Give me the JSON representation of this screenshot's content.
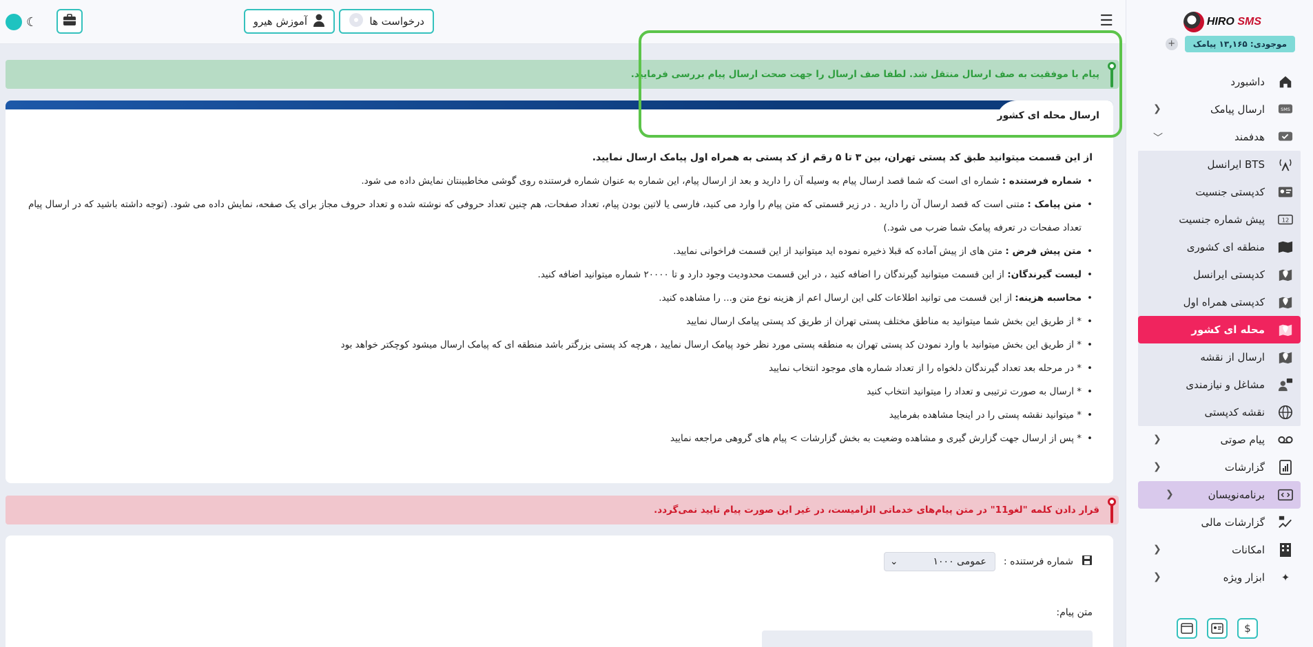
{
  "brand": {
    "logo_main": "HIRO",
    "logo_sub": "SMS"
  },
  "balance": {
    "label": "موجودی: ۱۳,۱۶۵ پیامک"
  },
  "sidebar": {
    "items": [
      {
        "label": "داشبورد",
        "icon": "home-icon"
      },
      {
        "label": "ارسال پیامک",
        "icon": "sms-icon"
      },
      {
        "label": "هدفمند",
        "icon": "target-icon"
      }
    ],
    "sub_items": [
      {
        "label": "BTS ایرانسل",
        "icon": "antenna-icon"
      },
      {
        "label": "کدپستی جنسیت",
        "icon": "id-card-icon"
      },
      {
        "label": "پیش شماره جنسیت",
        "icon": "number-icon"
      },
      {
        "label": "منطقه ای کشوری",
        "icon": "map-icon"
      },
      {
        "label": "کدپستی ایرانسل",
        "icon": "map-pin-icon"
      },
      {
        "label": "کدپستی همراه اول",
        "icon": "map-pin-icon"
      },
      {
        "label": "محله ای کشور",
        "icon": "location-icon"
      },
      {
        "label": "ارسال از نقشه",
        "icon": "map-pin-icon"
      },
      {
        "label": "مشاغل و نیازمندی",
        "icon": "user-chat-icon"
      },
      {
        "label": "نقشه کدپستی",
        "icon": "globe-icon"
      }
    ],
    "bottom_items": [
      {
        "label": "پیام صوتی",
        "icon": "voicemail-icon"
      },
      {
        "label": "گزارشات",
        "icon": "report-icon"
      },
      {
        "label": "برنامه‌نویسان",
        "icon": "code-icon"
      },
      {
        "label": "گزارشات مالی",
        "icon": "finance-icon"
      },
      {
        "label": "امکانات",
        "icon": "building-icon"
      },
      {
        "label": "ابزار ویژه",
        "icon": "sparkle-icon"
      }
    ]
  },
  "topbar": {
    "requests_label": "درخواست ها",
    "training_label": "آموزش هیرو"
  },
  "alerts": {
    "success": "پیام با موفقیت به صف ارسال منتقل شد. لطفا صف ارسال را جهت صحت ارسال پیام بررسی فرمایید.",
    "danger": "قرار دادن کلمه \"لغو11\" در متن پیام‌های خدماتی الزامیست، در غیر این صورت پیام تایید نمی‌گردد."
  },
  "card": {
    "title": "ارسال محله ای کشور",
    "intro": "از این قسمت میتوانید طبق کد پستی تهران، بین ۳ تا ۵ رقم از کد پستی به همراه اول پیامک ارسال نمایید.",
    "bullets": [
      {
        "strong": "شماره فرستنده :",
        "text": " شماره ای است که شما قصد ارسال پیام به وسیله آن را دارید و بعد از ارسال پیام، این شماره به عنوان شماره فرستنده روی گوشی مخاطبینتان نمایش داده می شود."
      },
      {
        "strong": "متن پیامک :",
        "text": " متنی است که قصد ارسال آن را دارید . در زیر قسمتی که متن پیام را وارد می کنید، فارسی یا لاتین بودن پیام، تعداد صفحات، هم چنین تعداد حروفی که نوشته شده و تعداد حروف مجاز برای یک صفحه، نمایش داده می شود. (توجه داشته باشید که در ارسال پیام تعداد صفحات در تعرفه پیامک شما ضرب می شود.)"
      },
      {
        "strong": "متن پیش فرض :",
        "text": " متن های از پیش آماده که قبلا ذخیره نموده اید میتوانید از این قسمت فراخوانی نمایید."
      },
      {
        "strong": "لیست گیرندگان:",
        "text": " از این قسمت میتوانید گیرندگان را اضافه کنید ، در این قسمت محدودیت وجود دارد و تا ۲۰۰۰۰ شماره میتوانید اضافه کنید."
      },
      {
        "strong": "محاسبه هزینه:",
        "text": " از این قسمت می توانید اطلاعات کلی این ارسال اعم از هزینه نوع متن و... را مشاهده کنید."
      },
      {
        "strong": "",
        "text": "* از طریق این بخش شما میتوانید به مناطق مختلف پستی تهران از طریق کد پستی پیامک ارسال نمایید"
      },
      {
        "strong": "",
        "text": "* از طریق این بخش میتوانید با وارد نمودن کد پستی تهران به منطقه پستی مورد نظر خود پیامک ارسال نمایید ، هرچه کد پستی بزرگتر باشد منطقه ای که پیامک ارسال میشود کوچکتر خواهد بود"
      },
      {
        "strong": "",
        "text": "* در مرحله بعد تعداد گیرندگان دلخواه را از تعداد شماره های موجود انتخاب نمایید"
      },
      {
        "strong": "",
        "text": "* ارسال به صورت ترتیبی و تعداد را میتوانید انتخاب کنید"
      },
      {
        "strong": "",
        "text": "* میتوانید نقشه پستی را در اینجا مشاهده بفرمایید"
      },
      {
        "strong": "",
        "text": "* پس از ارسال جهت گزارش گیری و مشاهده وضعیت به بخش گزارشات > پیام های گروهی مراجعه نمایید"
      }
    ]
  },
  "form": {
    "sender_label": "شماره فرستنده :",
    "sender_value": "عمومی ۱۰۰۰",
    "message_label": "متن پیام:"
  },
  "colors": {
    "accent": "#34c1bd",
    "active": "#f0245e",
    "band": "#0d3b7b",
    "success": "#2f9e3e",
    "danger": "#d0192b"
  }
}
